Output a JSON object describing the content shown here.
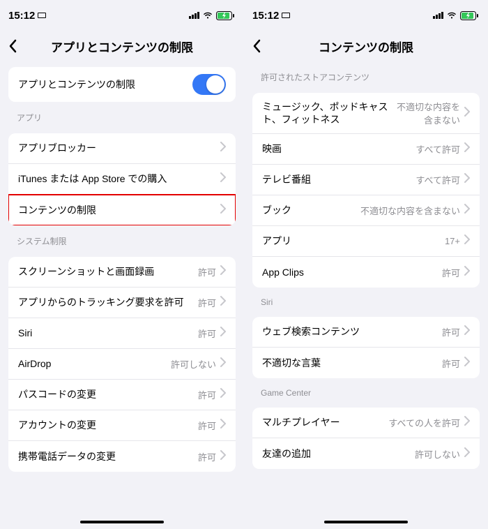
{
  "status": {
    "time": "15:12"
  },
  "left": {
    "title": "アプリとコンテンツの制限",
    "toggleRow": {
      "label": "アプリとコンテンツの制限",
      "on": true
    },
    "section_app_header": "アプリ",
    "app_rows": [
      {
        "label": "アプリブロッカー"
      },
      {
        "label": "iTunes または App Store での購入"
      },
      {
        "label": "コンテンツの制限",
        "highlighted": true
      }
    ],
    "section_system_header": "システム制限",
    "system_rows": [
      {
        "label": "スクリーンショットと画面録画",
        "value": "許可"
      },
      {
        "label": "アプリからのトラッキング要求を許可",
        "value": "許可"
      },
      {
        "label": "Siri",
        "value": "許可"
      },
      {
        "label": "AirDrop",
        "value": "許可しない"
      },
      {
        "label": "パスコードの変更",
        "value": "許可"
      },
      {
        "label": "アカウントの変更",
        "value": "許可"
      },
      {
        "label": "携帯電話データの変更",
        "value": "許可"
      }
    ]
  },
  "right": {
    "title": "コンテンツの制限",
    "section_store_header": "許可されたストアコンテンツ",
    "store_rows": [
      {
        "label": "ミュージック、ポッドキャスト、フィットネス",
        "value": "不適切な内容を含まない"
      },
      {
        "label": "映画",
        "value": "すべて許可"
      },
      {
        "label": "テレビ番組",
        "value": "すべて許可"
      },
      {
        "label": "ブック",
        "value": "不適切な内容を含まない"
      },
      {
        "label": "アプリ",
        "value": "17+"
      },
      {
        "label": "App Clips",
        "value": "許可"
      }
    ],
    "section_siri_header": "Siri",
    "siri_rows": [
      {
        "label": "ウェブ検索コンテンツ",
        "value": "許可"
      },
      {
        "label": "不適切な言葉",
        "value": "許可"
      }
    ],
    "section_gc_header": "Game Center",
    "gc_rows": [
      {
        "label": "マルチプレイヤー",
        "value": "すべての人を許可"
      },
      {
        "label": "友達の追加",
        "value": "許可しない"
      }
    ]
  }
}
